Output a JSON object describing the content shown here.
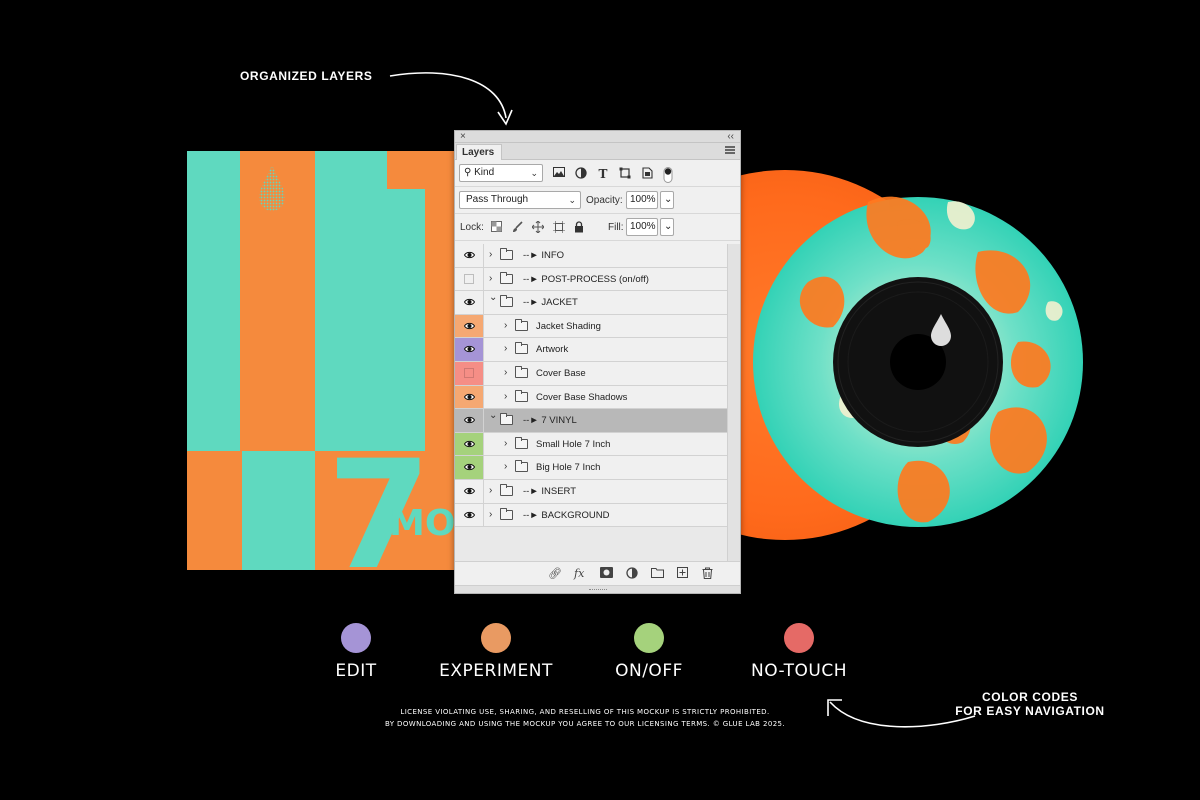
{
  "callouts": {
    "top": "ORGANIZED LAYERS",
    "right_line1": "COLOR CODES",
    "right_line2": "FOR EASY NAVIGATION"
  },
  "jacket": {
    "numeral": "7",
    "text_partial": "MO",
    "colors": {
      "teal": "#5fd9bf",
      "orange": "#f58a3d"
    }
  },
  "panel": {
    "close_glyph": "×",
    "collapse_glyph": "‹‹",
    "tab_label": "Layers",
    "filter": {
      "kind_label": "Kind"
    },
    "blend_mode": "Pass Through",
    "opacity_label": "Opacity:",
    "opacity_value": "100%",
    "lock_label": "Lock:",
    "fill_label": "Fill:",
    "fill_value": "100%",
    "layers": [
      {
        "name": "--► INFO",
        "indent": 0,
        "expanded": false,
        "visible": true,
        "color": null,
        "selected": false
      },
      {
        "name": "--► POST-PROCESS (on/off)",
        "indent": 0,
        "expanded": false,
        "visible": false,
        "color": null,
        "selected": false
      },
      {
        "name": "--► JACKET",
        "indent": 0,
        "expanded": true,
        "visible": true,
        "color": null,
        "selected": false
      },
      {
        "name": "Jacket Shading",
        "indent": 1,
        "expanded": false,
        "visible": true,
        "color": "#f5a872",
        "selected": false
      },
      {
        "name": "Artwork",
        "indent": 1,
        "expanded": false,
        "visible": true,
        "color": "#a594d6",
        "selected": false
      },
      {
        "name": "Cover Base",
        "indent": 1,
        "expanded": false,
        "visible": false,
        "color": "#f58e86",
        "selected": false
      },
      {
        "name": "Cover Base Shadows",
        "indent": 1,
        "expanded": false,
        "visible": true,
        "color": "#f5a872",
        "selected": false
      },
      {
        "name": "--► 7 VINYL",
        "indent": 0,
        "expanded": true,
        "visible": true,
        "color": null,
        "selected": true
      },
      {
        "name": "Small Hole 7 Inch",
        "indent": 1,
        "expanded": false,
        "visible": true,
        "color": "#a5d27c",
        "selected": false
      },
      {
        "name": "Big Hole 7 Inch",
        "indent": 1,
        "expanded": false,
        "visible": true,
        "color": "#a5d27c",
        "selected": false
      },
      {
        "name": "--► INSERT",
        "indent": 0,
        "expanded": false,
        "visible": true,
        "color": null,
        "selected": false
      },
      {
        "name": "--► BACKGROUND",
        "indent": 0,
        "expanded": false,
        "visible": true,
        "color": null,
        "selected": false
      }
    ]
  },
  "legend": [
    {
      "label": "EDIT",
      "color": "#a594d6"
    },
    {
      "label": "EXPERIMENT",
      "color": "#e99a62"
    },
    {
      "label": "ON/OFF",
      "color": "#a5d27c"
    },
    {
      "label": "NO-TOUCH",
      "color": "#e56a66"
    }
  ],
  "license": {
    "line1": "LICENSE VIOLATING USE, SHARING, AND RESELLING OF THIS MOCKUP IS STRICTLY PROHIBITED.",
    "line2": "BY DOWNLOADING AND USING THE MOCKUP YOU AGREE TO OUR LICENSING TERMS. © GLUE LAB 2025."
  }
}
